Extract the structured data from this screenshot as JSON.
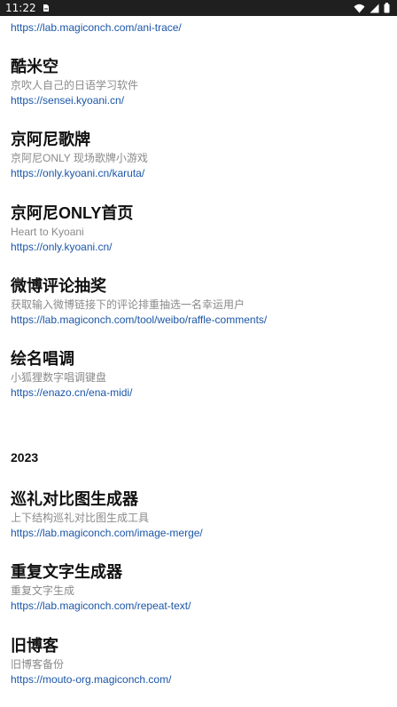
{
  "status_bar": {
    "time": "11:22"
  },
  "cut_off_item": {
    "link": "https://lab.magiconch.com/ani-trace/"
  },
  "items_2024": [
    {
      "title": "酷米空",
      "desc": "京吹人自己的日语学习软件",
      "link": "https://sensei.kyoani.cn/"
    },
    {
      "title": "京阿尼歌牌",
      "desc": "京阿尼ONLY 现场歌牌小游戏",
      "link": "https://only.kyoani.cn/karuta/"
    },
    {
      "title": "京阿尼ONLY首页",
      "desc": "Heart to Kyoani",
      "link": "https://only.kyoani.cn/"
    },
    {
      "title": "微博评论抽奖",
      "desc": "获取输入微博链接下的评论排重抽选一名幸运用户",
      "link": "https://lab.magiconch.com/tool/weibo/raffle-comments/"
    },
    {
      "title": "绘名唱调",
      "desc": "小狐狸数字唱调键盘",
      "link": "https://enazo.cn/ena-midi/"
    }
  ],
  "year_heading": "2023",
  "items_2023": [
    {
      "title": "巡礼对比图生成器",
      "desc": "上下结构巡礼对比图生成工具",
      "link": "https://lab.magiconch.com/image-merge/"
    },
    {
      "title": "重复文字生成器",
      "desc": "重复文字生成",
      "link": "https://lab.magiconch.com/repeat-text/"
    },
    {
      "title": "旧博客",
      "desc": "旧博客备份",
      "link": "https://mouto-org.magiconch.com/"
    }
  ]
}
